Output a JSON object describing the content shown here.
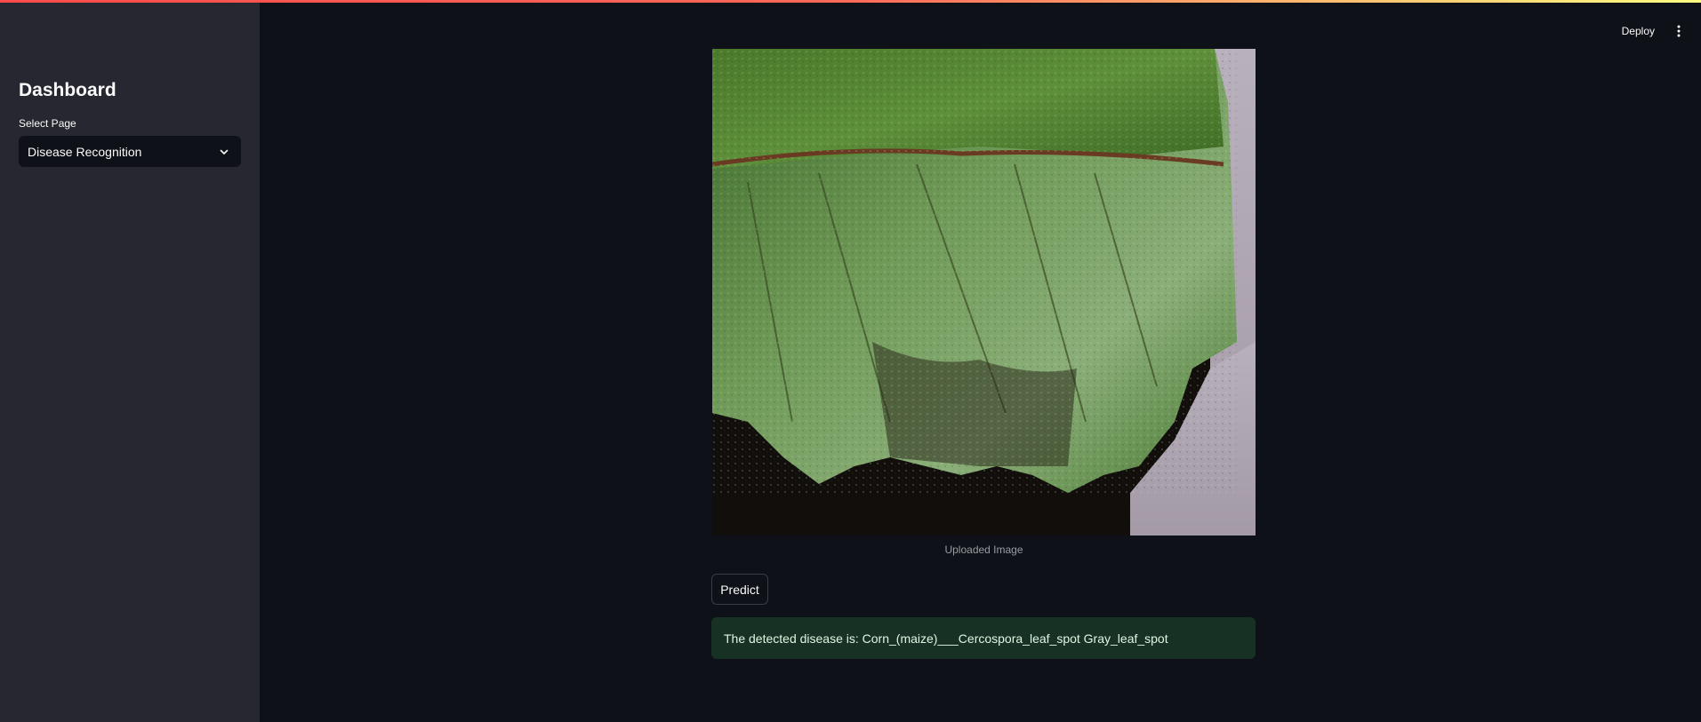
{
  "sidebar": {
    "title": "Dashboard",
    "select_label": "Select Page",
    "selected_page": "Disease Recognition"
  },
  "header": {
    "deploy_label": "Deploy"
  },
  "main": {
    "image_caption": "Uploaded Image",
    "predict_label": "Predict",
    "result_text": "The detected disease is: Corn_(maize)___Cercospora_leaf_spot Gray_leaf_spot"
  },
  "colors": {
    "sidebar_bg": "#262730",
    "main_bg": "#0e1117",
    "success_bg": "#173224",
    "accent": "#ff4b4b"
  },
  "icons": {
    "select_chevron": "chevron-down-icon",
    "header_menu": "more-vert-icon"
  }
}
